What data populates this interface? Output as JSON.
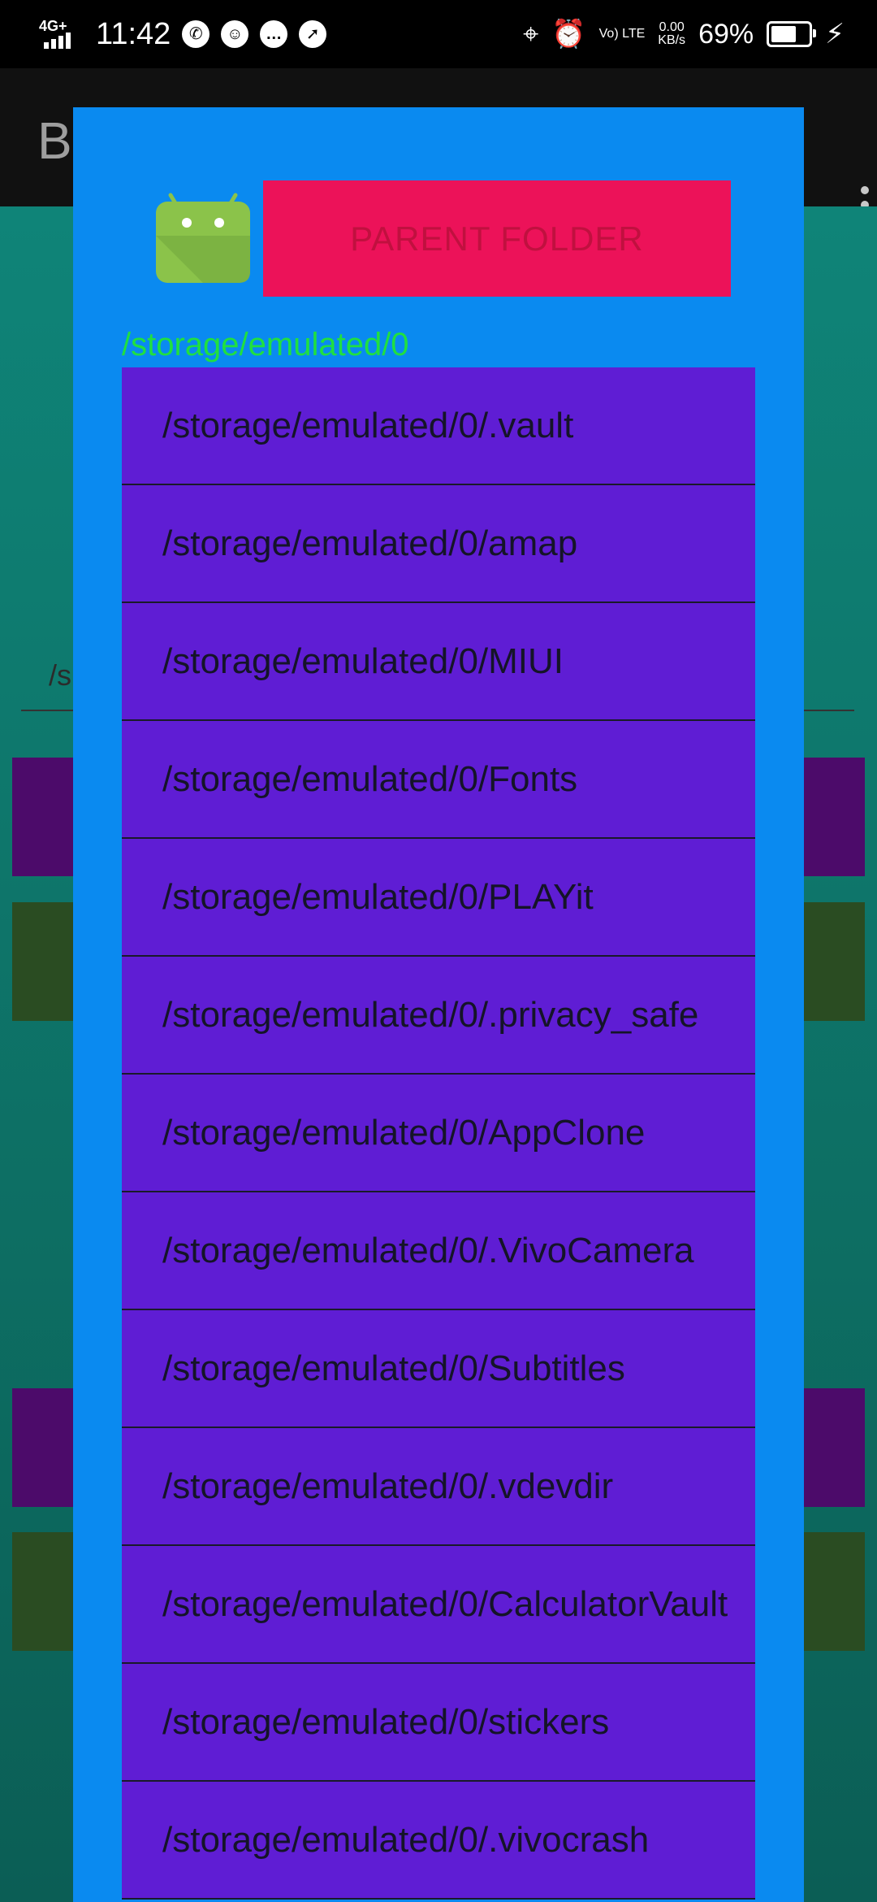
{
  "status_bar": {
    "network": "4G+",
    "time": "11:42",
    "volte": "Vo) LTE",
    "net_speed_value": "0.00",
    "net_speed_unit": "KB/s",
    "battery_percent": "69%",
    "battery_level": 0.69
  },
  "app": {
    "title_partial": "B",
    "input_partial": "/s"
  },
  "dialog": {
    "parent_button_label": "PARENT FOLDER",
    "current_path": "/storage/emulated/0",
    "items": [
      {
        "label": "/storage/emulated/0/.vault"
      },
      {
        "label": "/storage/emulated/0/amap"
      },
      {
        "label": "/storage/emulated/0/MIUI"
      },
      {
        "label": "/storage/emulated/0/Fonts"
      },
      {
        "label": "/storage/emulated/0/PLAYit"
      },
      {
        "label": "/storage/emulated/0/.privacy_safe"
      },
      {
        "label": "/storage/emulated/0/AppClone"
      },
      {
        "label": "/storage/emulated/0/.VivoCamera"
      },
      {
        "label": "/storage/emulated/0/Subtitles"
      },
      {
        "label": "/storage/emulated/0/.vdevdir"
      },
      {
        "label": "/storage/emulated/0/CalculatorVault"
      },
      {
        "label": "/storage/emulated/0/stickers"
      },
      {
        "label": "/storage/emulated/0/.vivocrash"
      }
    ]
  },
  "colors": {
    "dialog_bg": "#0a8af0",
    "parent_button": "#ec1259",
    "list_item": "#5f1dd4",
    "path_text": "#20e040",
    "bg_teal": "#0f8478"
  }
}
